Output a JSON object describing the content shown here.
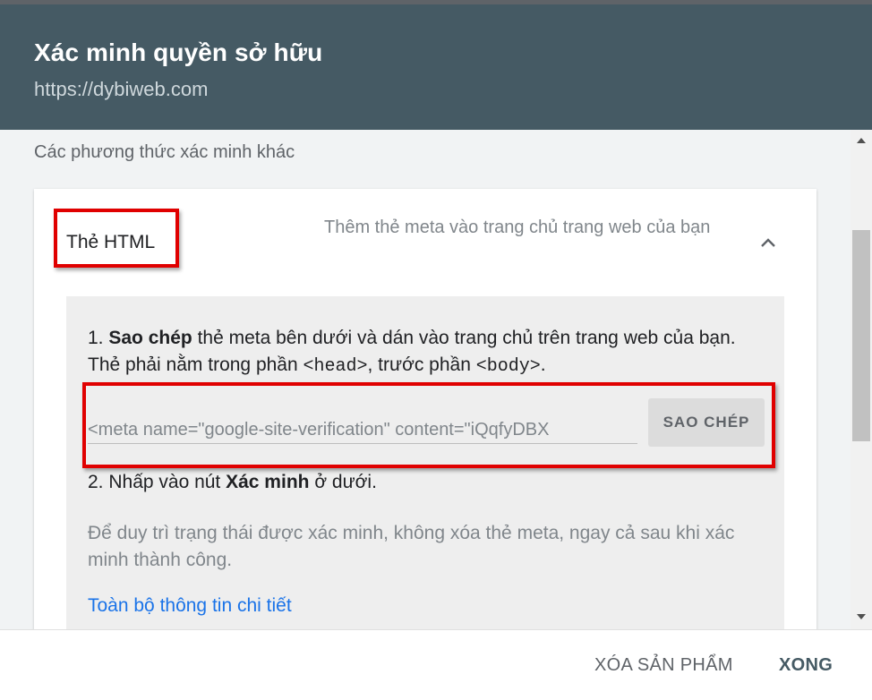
{
  "dialog": {
    "title": "Xác minh quyền sở hữu",
    "subtitle": "https://dybiweb.com"
  },
  "content": {
    "other_methods_label": "Các phương thức xác minh khác",
    "method": {
      "name": "Thẻ HTML",
      "description": "Thêm thẻ meta vào trang chủ trang web của bạn",
      "expanded": true,
      "chevron_icon": "chevron-up-icon"
    },
    "steps": {
      "step1_prefix": "1. ",
      "step1_bold": "Sao chép",
      "step1_text_a": " thẻ meta bên dưới và dán vào trang chủ trên trang web của bạn. Thẻ phải nằm trong phần ",
      "step1_code_head": "<head>",
      "step1_text_b": ", trước phần ",
      "step1_code_body": "<body>",
      "step1_text_c": ".",
      "meta_tag_value": "<meta name=\"google-site-verification\" content=\"iQqfyDBX",
      "copy_button": "SAO CHÉP",
      "step2_prefix": "2. Nhấp vào nút ",
      "step2_bold": "Xác minh",
      "step2_suffix": " ở dưới.",
      "note": "Để duy trì trạng thái được xác minh, không xóa thẻ meta, ngay cả sau khi xác minh thành công.",
      "details_link": "Toàn bộ thông tin chi tiết"
    }
  },
  "footer": {
    "remove_button": "XÓA SẢN PHẨM",
    "done_button": "XONG"
  },
  "colors": {
    "header_bg": "#455a64",
    "highlight": "#e00000",
    "link": "#1a73e8"
  }
}
